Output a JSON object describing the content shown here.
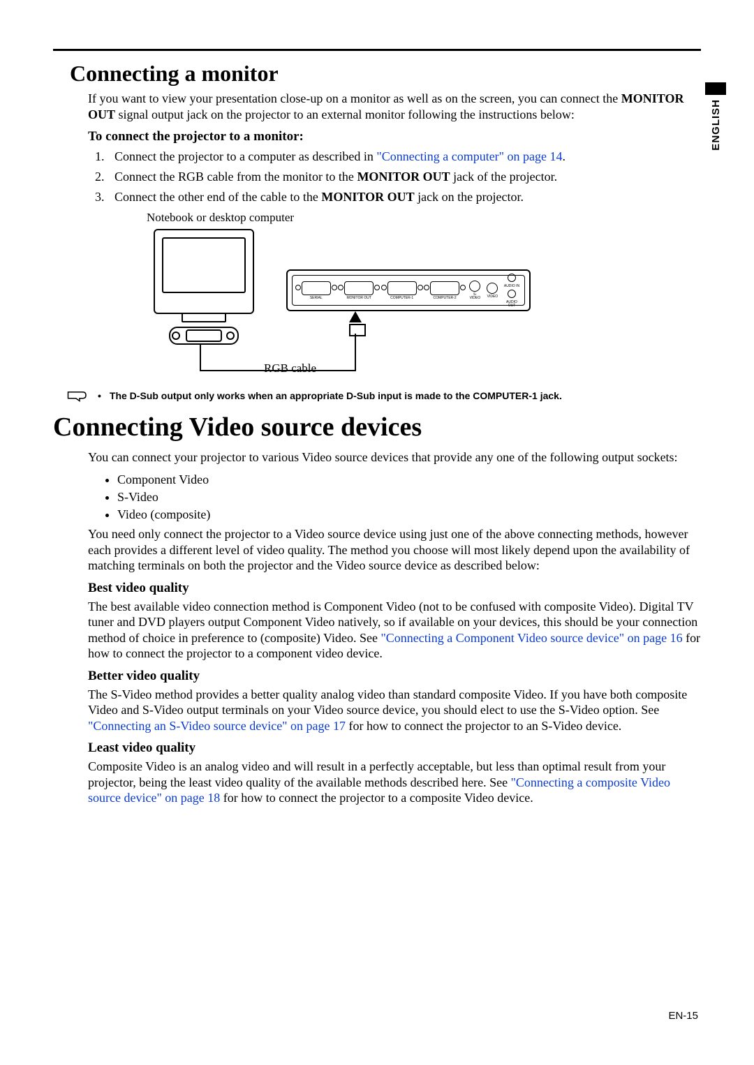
{
  "language_tab": "ENGLISH",
  "section1": {
    "title": "Connecting a monitor",
    "intro_pre": "If you want to view your presentation close-up on a monitor as well as on the screen, you can connect the ",
    "intro_bold": "MONITOR OUT",
    "intro_post": " signal output jack on the projector to an external monitor following the instructions below:",
    "subhead": "To connect the projector to a monitor:",
    "step1_pre": "Connect the projector to a computer as described in ",
    "step1_link": "\"Connecting a computer\" on page 14",
    "step1_post": ".",
    "step2_pre": "Connect the RGB cable from the monitor to the ",
    "step2_bold": "MONITOR OUT",
    "step2_post": " jack of the projector.",
    "step3_pre": "Connect the other end of the cable to the ",
    "step3_bold": "MONITOR OUT",
    "step3_post": " jack on the projector.",
    "fig_caption": "Notebook or desktop computer",
    "fig_cable": "RGB cable",
    "port_labels": [
      "SERIAL",
      "MONITOR OUT",
      "COMPUTER-1",
      "COMPUTER-2",
      "S-VIDEO",
      "VIDEO",
      "AUDIO IN",
      "AUDIO OUT"
    ],
    "note": "The D-Sub output only works when an appropriate D-Sub input is made to the COMPUTER-1 jack."
  },
  "section2": {
    "title": "Connecting Video source devices",
    "intro": "You can connect your projector to various Video source devices that provide any one of the following output sockets:",
    "bullets": [
      "Component Video",
      "S-Video",
      "Video (composite)"
    ],
    "after_bullets": "You need only connect the projector to a Video source device using just one of the above connecting methods, however each provides a different level of video quality. The method you choose will most likely depend upon the availability of matching terminals on both the projector and the Video source device as described below:",
    "best_head": "Best video quality",
    "best_pre": "The best available video connection method is Component Video (not to be confused with composite Video). Digital TV tuner and DVD players output Component Video natively, so if available on your devices, this should be your connection method of choice in preference to (composite) Video. See ",
    "best_link": "\"Connecting a Component Video source device\" on page 16",
    "best_post": " for how to connect the projector to a component video device.",
    "better_head": "Better video quality",
    "better_pre": "The S-Video method provides a better quality analog video than standard composite Video. If you have both composite Video and S-Video output terminals on your Video source device, you should elect to use the S-Video option. See ",
    "better_link": "\"Connecting an S-Video source device\" on page 17",
    "better_post": " for how to connect the projector to an S-Video device.",
    "least_head": "Least video quality",
    "least_pre": "Composite Video is an analog video and will result in a perfectly acceptable, but less than optimal result from your projector, being the least video quality of the available methods described here. See ",
    "least_link": "\"Connecting a composite Video source device\" on page 18",
    "least_post": " for how to connect the projector to a composite Video device."
  },
  "footer": "EN-15"
}
